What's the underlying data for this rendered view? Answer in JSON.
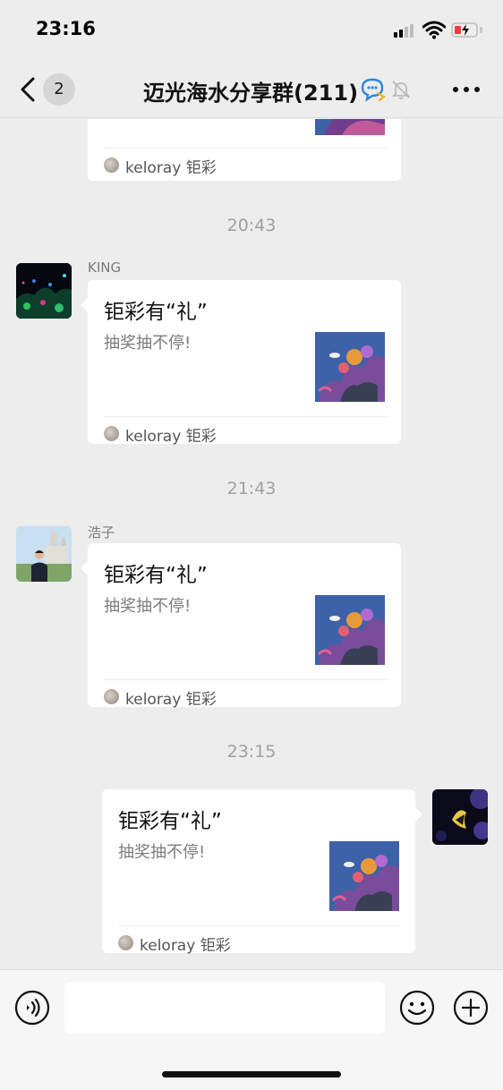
{
  "status_bar": {
    "time": "23:16"
  },
  "nav": {
    "back_count": "2",
    "title": "迈光海水分享群(211)"
  },
  "messages": [
    {
      "type": "card_partial",
      "source": "keloray 钜彩"
    },
    {
      "type": "timestamp",
      "text": "20:43"
    },
    {
      "type": "card",
      "sender": "KING",
      "title": "钜彩有“礼”",
      "desc": "抽奖抽不停!",
      "source": "keloray 钜彩"
    },
    {
      "type": "timestamp",
      "text": "21:43"
    },
    {
      "type": "card",
      "sender": "浩子",
      "title": "钜彩有“礼”",
      "desc": "抽奖抽不停!",
      "source": "keloray 钜彩"
    },
    {
      "type": "timestamp",
      "text": "23:15"
    },
    {
      "type": "card_self",
      "title": "钜彩有“礼”",
      "desc": "抽奖抽不停!",
      "source": "keloray 钜彩"
    }
  ],
  "input_bar": {
    "placeholder": ""
  },
  "icons": {
    "back": "chevron-left-icon",
    "group_chat": "chat-bubbles-icon",
    "muted": "bell-slash-icon",
    "more": "more-dots-icon",
    "voice": "voice-icon",
    "emoji": "emoji-icon",
    "plus": "plus-icon"
  },
  "colors": {
    "background": "#ededed",
    "card": "#ffffff",
    "muted_text": "#a0a0a0",
    "battery_low": "#ea3d3d"
  }
}
